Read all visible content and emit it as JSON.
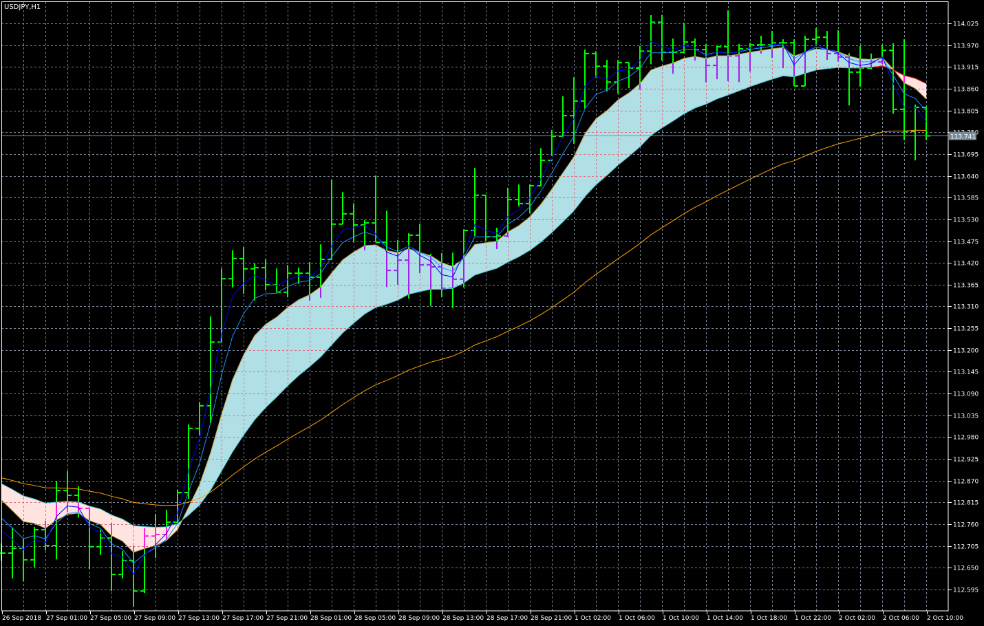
{
  "chart_data": {
    "type": "ohlc",
    "title": "USDJPY,H1",
    "symbol": "USDJPY",
    "timeframe": "H1",
    "current_price": "113.741",
    "ylim": [
      112.541,
      114.079
    ],
    "grid": true,
    "y_ticks": [
      "114.025",
      "113.970",
      "113.915",
      "113.860",
      "113.805",
      "113.750",
      "113.695",
      "113.640",
      "113.585",
      "113.530",
      "113.475",
      "113.420",
      "113.365",
      "113.310",
      "113.255",
      "113.200",
      "113.145",
      "113.090",
      "113.035",
      "112.980",
      "112.925",
      "112.870",
      "112.815",
      "112.760",
      "112.705",
      "112.650",
      "112.595"
    ],
    "x_ticks": [
      "26 Sep 2018",
      "27 Sep 01:00",
      "27 Sep 05:00",
      "27 Sep 09:00",
      "27 Sep 13:00",
      "27 Sep 17:00",
      "27 Sep 21:00",
      "28 Sep 01:00",
      "28 Sep 05:00",
      "28 Sep 09:00",
      "28 Sep 13:00",
      "28 Sep 17:00",
      "28 Sep 21:00",
      "1 Oct 02:00",
      "1 Oct 06:00",
      "1 Oct 10:00",
      "1 Oct 14:00",
      "1 Oct 18:00",
      "1 Oct 22:00",
      "2 Oct 02:00",
      "2 Oct 06:00",
      "2 Oct 10:00"
    ],
    "x_tick_every_bars": 4,
    "ohlc_fields": [
      "open",
      "high",
      "low",
      "close"
    ],
    "bars": [
      [
        112.687,
        112.711,
        112.668,
        112.687
      ],
      [
        112.687,
        112.751,
        112.623,
        112.699
      ],
      [
        112.699,
        112.724,
        112.616,
        112.67
      ],
      [
        112.67,
        112.753,
        112.651,
        112.746
      ],
      [
        112.746,
        112.769,
        112.694,
        112.706
      ],
      [
        112.706,
        112.869,
        112.671,
        112.845
      ],
      [
        112.845,
        112.894,
        112.79,
        112.833
      ],
      [
        112.833,
        112.856,
        112.777,
        112.8
      ],
      [
        112.8,
        112.802,
        112.647,
        112.703
      ],
      [
        112.703,
        112.746,
        112.682,
        112.725
      ],
      [
        112.725,
        112.763,
        112.591,
        112.633
      ],
      [
        112.633,
        112.692,
        112.623,
        112.668
      ],
      [
        112.668,
        112.706,
        112.551,
        112.591
      ],
      [
        112.591,
        112.75,
        112.586,
        112.73
      ],
      [
        112.73,
        112.786,
        112.675,
        112.734
      ],
      [
        112.734,
        112.796,
        112.718,
        112.765
      ],
      [
        112.765,
        112.847,
        112.765,
        112.84
      ],
      [
        112.84,
        113.012,
        112.824,
        113.002
      ],
      [
        113.002,
        113.069,
        112.984,
        113.059
      ],
      [
        113.059,
        113.285,
        113.015,
        113.22
      ],
      [
        113.22,
        113.406,
        113.219,
        113.38
      ],
      [
        113.38,
        113.452,
        113.358,
        113.431
      ],
      [
        113.431,
        113.46,
        113.342,
        113.405
      ],
      [
        113.405,
        113.419,
        113.325,
        113.408
      ],
      [
        113.408,
        113.429,
        113.351,
        113.365
      ],
      [
        113.365,
        113.406,
        113.346,
        113.346
      ],
      [
        113.346,
        113.415,
        113.333,
        113.394
      ],
      [
        113.394,
        113.408,
        113.367,
        113.394
      ],
      [
        113.394,
        113.422,
        113.325,
        113.384
      ],
      [
        113.384,
        113.467,
        113.332,
        113.429
      ],
      [
        113.429,
        113.631,
        113.429,
        113.518
      ],
      [
        113.518,
        113.599,
        113.518,
        113.544
      ],
      [
        113.544,
        113.571,
        113.472,
        113.516
      ],
      [
        113.516,
        113.528,
        113.452,
        113.521
      ],
      [
        113.521,
        113.641,
        113.472,
        113.472
      ],
      [
        113.472,
        113.552,
        113.359,
        113.401
      ],
      [
        113.401,
        113.478,
        113.365,
        113.427
      ],
      [
        113.427,
        113.495,
        113.33,
        113.49
      ],
      [
        113.49,
        113.519,
        113.394,
        113.415
      ],
      [
        113.415,
        113.443,
        113.311,
        113.41
      ],
      [
        113.41,
        113.445,
        113.333,
        113.356
      ],
      [
        113.356,
        113.446,
        113.306,
        113.379
      ],
      [
        113.379,
        113.505,
        113.358,
        113.502
      ],
      [
        113.502,
        113.66,
        113.488,
        113.591
      ],
      [
        113.591,
        113.592,
        113.476,
        113.486
      ],
      [
        113.486,
        113.509,
        113.455,
        113.488
      ],
      [
        113.488,
        113.61,
        113.485,
        113.58
      ],
      [
        113.58,
        113.618,
        113.563,
        113.57
      ],
      [
        113.57,
        113.618,
        113.545,
        113.615
      ],
      [
        113.615,
        113.71,
        113.613,
        113.679
      ],
      [
        113.679,
        113.756,
        113.69,
        113.74
      ],
      [
        113.74,
        113.841,
        113.737,
        113.792
      ],
      [
        113.792,
        113.889,
        113.721,
        113.829
      ],
      [
        113.829,
        113.959,
        113.81,
        113.949
      ],
      [
        113.949,
        113.955,
        113.888,
        113.917
      ],
      [
        113.917,
        113.933,
        113.853,
        113.877
      ],
      [
        113.877,
        113.933,
        113.848,
        113.926
      ],
      [
        113.926,
        113.926,
        113.862,
        113.912
      ],
      [
        113.912,
        113.968,
        113.858,
        113.955
      ],
      [
        113.955,
        114.046,
        113.922,
        114.028
      ],
      [
        114.028,
        114.046,
        113.931,
        113.952
      ],
      [
        113.952,
        113.987,
        113.898,
        113.952
      ],
      [
        113.952,
        114.027,
        113.95,
        113.978
      ],
      [
        113.978,
        113.987,
        113.931,
        113.959
      ],
      [
        113.959,
        113.973,
        113.876,
        113.919
      ],
      [
        113.919,
        113.969,
        113.884,
        113.966
      ],
      [
        113.966,
        114.058,
        113.879,
        113.943
      ],
      [
        113.943,
        113.973,
        113.877,
        113.961
      ],
      [
        113.961,
        113.976,
        113.903,
        113.971
      ],
      [
        113.971,
        113.994,
        113.949,
        113.971
      ],
      [
        113.971,
        114.006,
        113.938,
        113.976
      ],
      [
        113.976,
        113.985,
        113.912,
        113.976
      ],
      [
        113.976,
        113.985,
        113.867,
        113.867
      ],
      [
        113.867,
        113.994,
        113.867,
        113.985
      ],
      [
        113.985,
        114.013,
        113.969,
        113.99
      ],
      [
        113.99,
        114.006,
        113.933,
        113.949
      ],
      [
        113.949,
        114.008,
        113.929,
        113.94
      ],
      [
        113.94,
        113.95,
        113.818,
        113.902
      ],
      [
        113.902,
        113.968,
        113.865,
        113.912
      ],
      [
        113.912,
        113.949,
        113.909,
        113.928
      ],
      [
        113.928,
        113.971,
        113.922,
        113.957
      ],
      [
        113.957,
        113.975,
        113.797,
        113.808
      ],
      [
        113.808,
        113.985,
        113.73,
        113.752
      ],
      [
        113.752,
        113.82,
        113.679,
        113.813
      ],
      [
        113.813,
        113.815,
        113.731,
        113.741
      ]
    ],
    "colors": {
      "background": "#000000",
      "grid": "#7b8799",
      "bar_up": "#00ff00",
      "bar_in_bull_ribbon": "#a020f0",
      "bar_in_bear_ribbon": "#ff20e0",
      "ribbon_bull": "#b0dfe6",
      "ribbon_bear": "#ffe4e1",
      "fast_line": "#0000ff",
      "mid_line": "#1e90ff",
      "slow_line": "#ffa500",
      "bear_edge": "#ff0000",
      "axis": "#ffffff",
      "price_label_bg": "#778899"
    }
  }
}
